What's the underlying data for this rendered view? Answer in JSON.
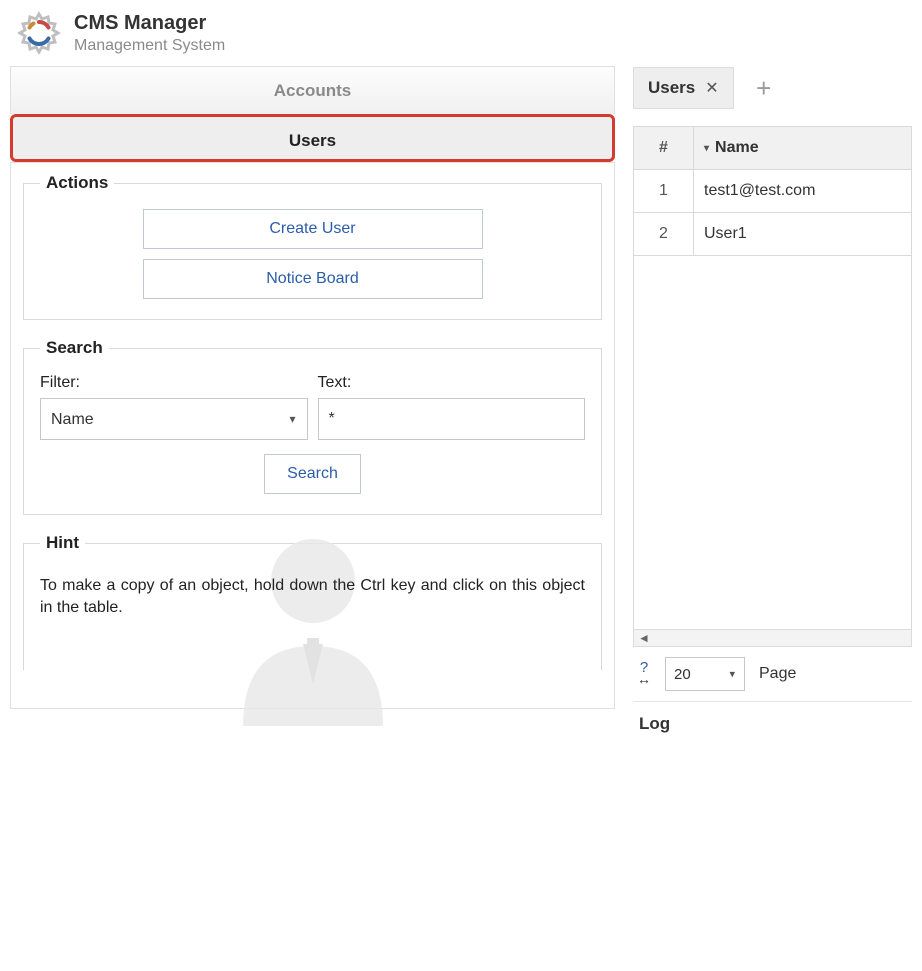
{
  "header": {
    "title": "CMS Manager",
    "subtitle": "Management System"
  },
  "nav": {
    "tab_accounts": "Accounts",
    "tab_users": "Users"
  },
  "actions": {
    "legend": "Actions",
    "create_user": "Create User",
    "notice_board": "Notice Board"
  },
  "search": {
    "legend": "Search",
    "filter_label": "Filter:",
    "filter_value": "Name",
    "text_label": "Text:",
    "text_value": "*",
    "submit": "Search"
  },
  "hint": {
    "legend": "Hint",
    "text": "To make a copy of an object, hold down the Ctrl key and click on this object in the table."
  },
  "tabs": {
    "users_tab": "Users"
  },
  "grid": {
    "col_num": "#",
    "col_name": "Name",
    "rows": [
      {
        "n": "1",
        "name": "test1@test.com"
      },
      {
        "n": "2",
        "name": "User1"
      }
    ]
  },
  "pager": {
    "page_size": "20",
    "page_label": "Page"
  },
  "log": {
    "header": "Log"
  }
}
